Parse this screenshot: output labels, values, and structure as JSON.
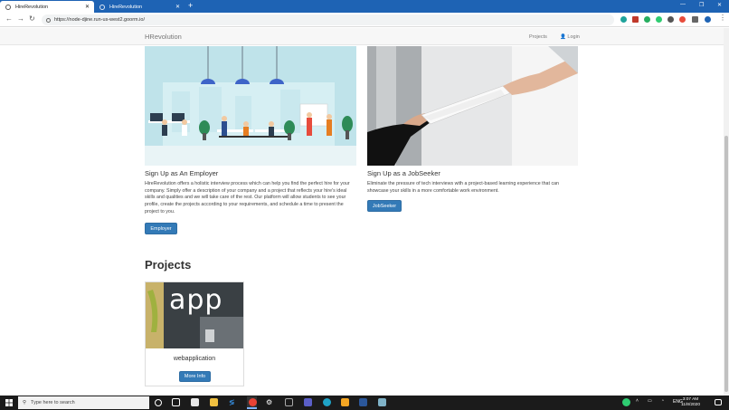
{
  "browser": {
    "tabs": [
      {
        "label": "HireRevolution",
        "active": true
      },
      {
        "label": "HireRevolution",
        "active": false
      }
    ],
    "new_tab": "+",
    "url": "https://node-djine.run-us-west2.goorm.io/",
    "window_controls": {
      "minimize": "—",
      "restore": "❐",
      "close": "✕"
    }
  },
  "site": {
    "brand": "HRevolution",
    "nav": {
      "projects": "Projects",
      "login": "Login"
    }
  },
  "employer": {
    "heading": "Sign Up as An Employer",
    "description": "HireRevolution offers a holistic interview process which can help you find the perfect hire for your company. Simply offer a description of your company and a project that reflects your hire's ideal skills and qualities and we will take care of the rest. Our platform will allow students to see your profile, create the projects according to your requirements, and schedule a time to present the project to you.",
    "button": "Employer"
  },
  "jobseeker": {
    "heading": "Sign Up as a JobSeeker",
    "description": "Eliminate the pressure of tech interviews with a project-based learning experience that can showcase your skills in a more comfortable work environment.",
    "button": "JobSeeker"
  },
  "projects": {
    "heading": "Projects",
    "cards": [
      {
        "image_text": "app",
        "title": "webapplication",
        "button": "More Info"
      }
    ]
  },
  "taskbar": {
    "search_placeholder": "Type here to search",
    "language": "ENG",
    "time": "3:07 AM",
    "date": "11/8/2020"
  },
  "colors": {
    "primary": "#337ab7",
    "tabstrip": "#1e63b4",
    "taskbar": "#1b1b1b"
  }
}
